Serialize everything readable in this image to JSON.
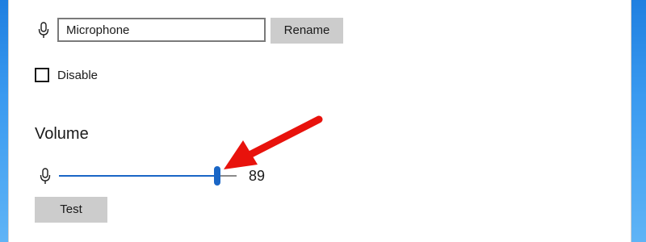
{
  "device": {
    "name_value": "Microphone",
    "rename_label": "Rename",
    "icon": "microphone-icon"
  },
  "disable": {
    "label": "Disable",
    "checked": false
  },
  "volume": {
    "heading": "Volume",
    "value": "89",
    "level_percent": 89,
    "icon": "microphone-icon",
    "test_label": "Test"
  },
  "annotation": {
    "icon": "arrow-icon",
    "color": "#e8120c"
  },
  "colors": {
    "accent": "#1a66c6",
    "button_bg": "#cccccc",
    "desktop": "#2a8ae8"
  }
}
